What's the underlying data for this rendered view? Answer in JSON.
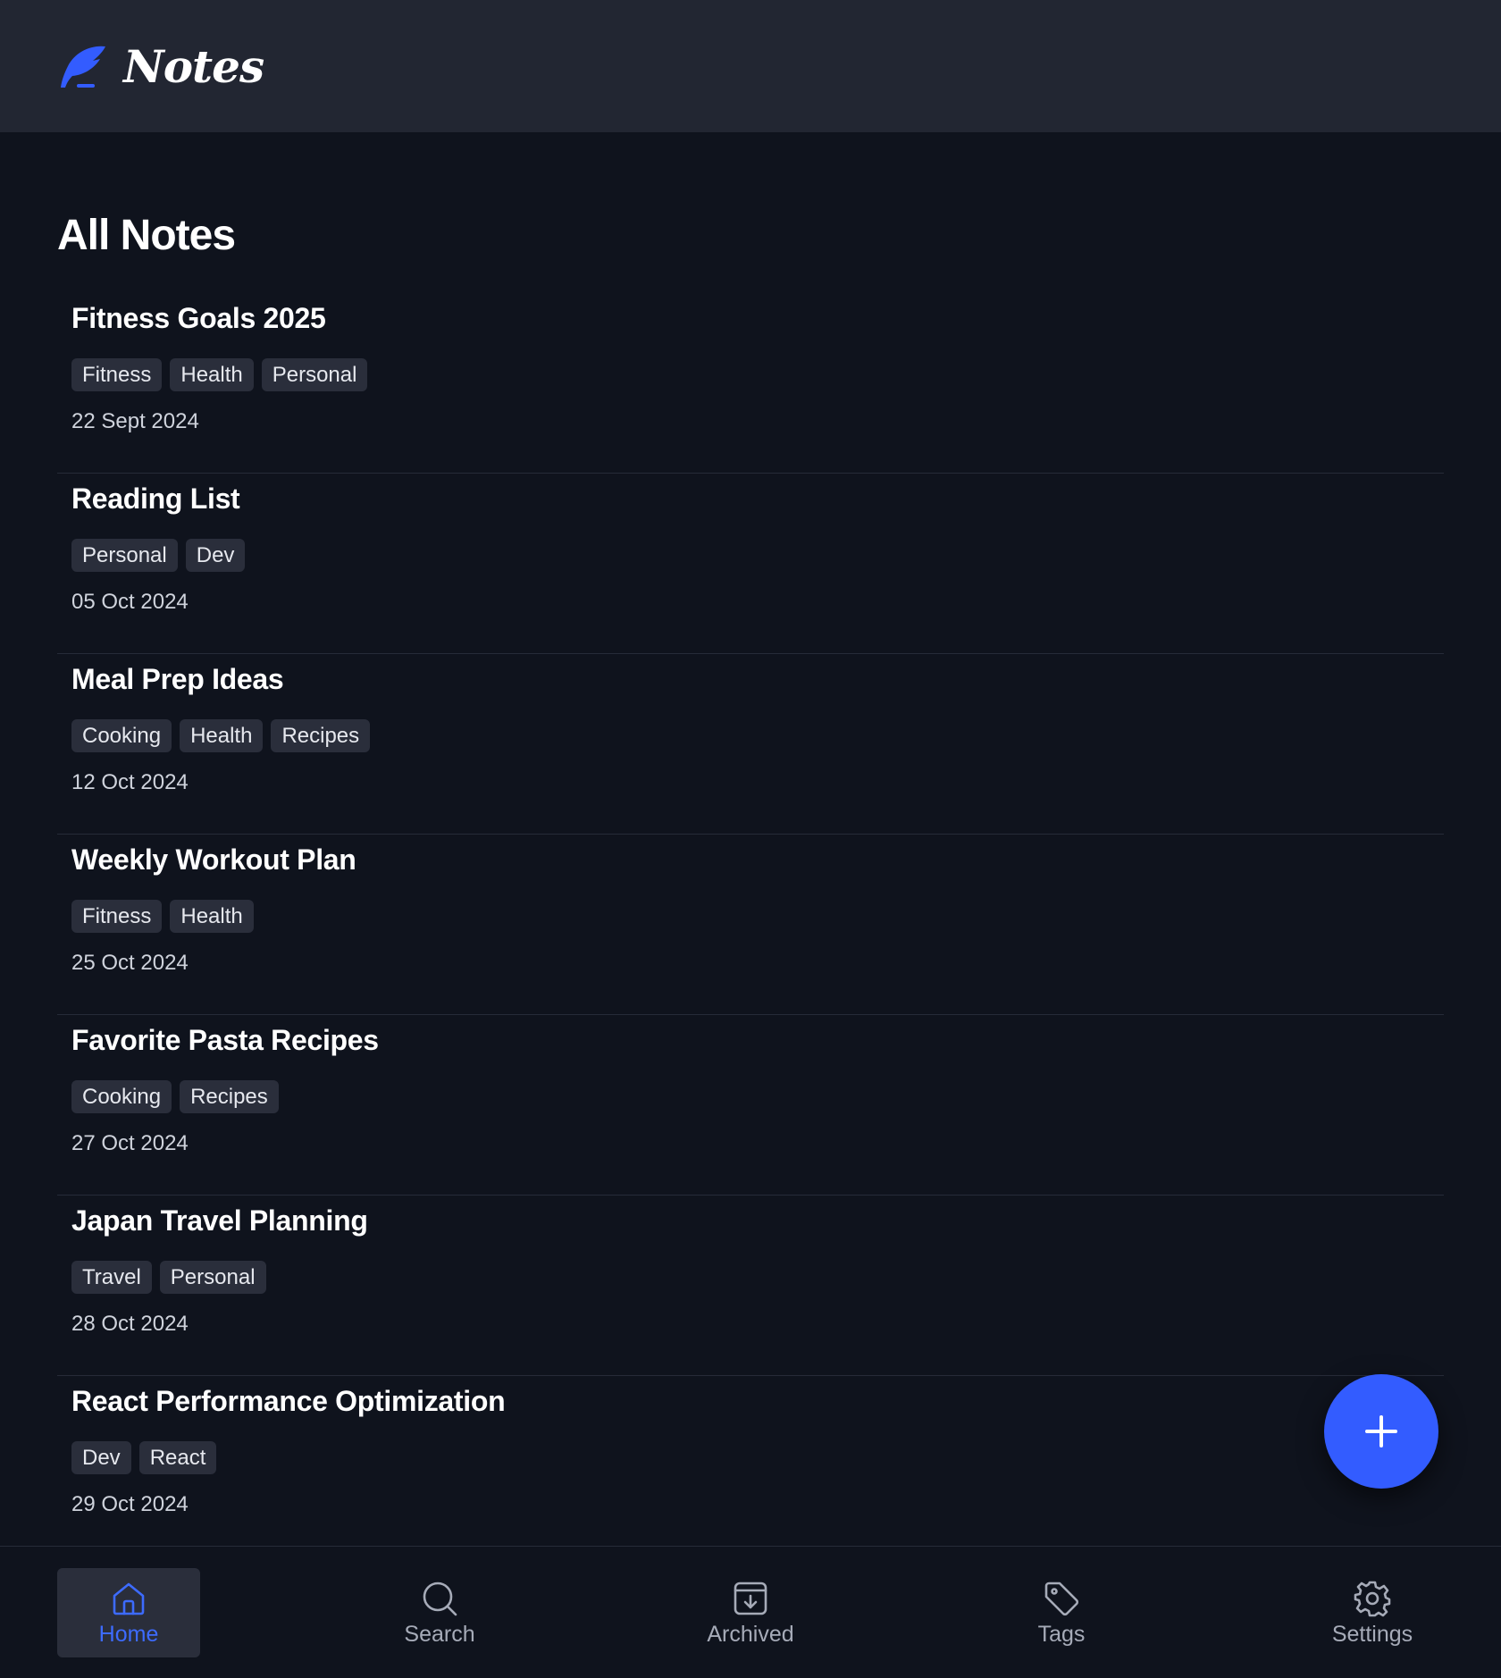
{
  "app": {
    "name": "Notes"
  },
  "main": {
    "title": "All Notes"
  },
  "notes": [
    {
      "title": "Fitness Goals 2025",
      "tags": [
        "Fitness",
        "Health",
        "Personal"
      ],
      "date": "22 Sept 2024"
    },
    {
      "title": "Reading List",
      "tags": [
        "Personal",
        "Dev"
      ],
      "date": "05 Oct 2024"
    },
    {
      "title": "Meal Prep Ideas",
      "tags": [
        "Cooking",
        "Health",
        "Recipes"
      ],
      "date": "12 Oct 2024"
    },
    {
      "title": "Weekly Workout Plan",
      "tags": [
        "Fitness",
        "Health"
      ],
      "date": "25 Oct 2024"
    },
    {
      "title": "Favorite Pasta Recipes",
      "tags": [
        "Cooking",
        "Recipes"
      ],
      "date": "27 Oct 2024"
    },
    {
      "title": "Japan Travel Planning",
      "tags": [
        "Travel",
        "Personal"
      ],
      "date": "28 Oct 2024"
    },
    {
      "title": "React Performance Optimization",
      "tags": [
        "Dev",
        "React"
      ],
      "date": "29 Oct 2024"
    }
  ],
  "fab": {
    "icon": "plus-icon"
  },
  "nav": {
    "items": [
      {
        "label": "Home",
        "icon": "home-icon",
        "active": true
      },
      {
        "label": "Search",
        "icon": "search-icon",
        "active": false
      },
      {
        "label": "Archived",
        "icon": "archive-icon",
        "active": false
      },
      {
        "label": "Tags",
        "icon": "tag-icon",
        "active": false
      },
      {
        "label": "Settings",
        "icon": "settings-icon",
        "active": false
      }
    ]
  },
  "colors": {
    "accent": "#335cff",
    "header_bg": "#222632",
    "page_bg": "#0f131d",
    "tag_bg": "#2a2e3b"
  }
}
